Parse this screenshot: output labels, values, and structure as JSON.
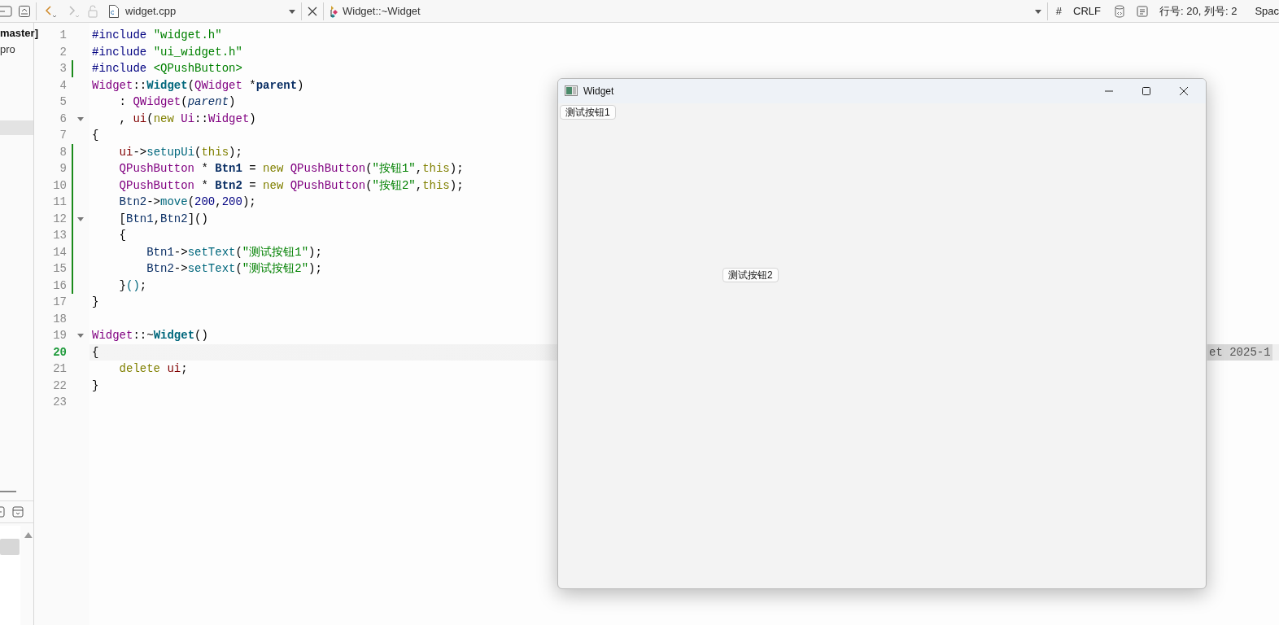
{
  "sidebar": {
    "items": [
      {
        "label": "master]",
        "bold": true
      },
      {
        "label": "pro",
        "bold": false
      }
    ]
  },
  "toolbar": {
    "file_name": "widget.cpp",
    "symbol": "Widget::~Widget",
    "hash": "#",
    "line_ending": "CRLF",
    "position": "行号: 20, 列号: 2",
    "indent": "Spac"
  },
  "editor": {
    "annotation": "et 2025-1",
    "lines": [
      {
        "number": "1",
        "changed": false,
        "foldable": false,
        "current": false,
        "tokens": [
          {
            "kind": "pp",
            "text": "#include "
          },
          {
            "kind": "str",
            "text": "\"widget.h\""
          }
        ]
      },
      {
        "number": "2",
        "changed": false,
        "foldable": false,
        "current": false,
        "tokens": [
          {
            "kind": "pp",
            "text": "#include "
          },
          {
            "kind": "str",
            "text": "\"ui_widget.h\""
          }
        ]
      },
      {
        "number": "3",
        "changed": true,
        "foldable": false,
        "current": false,
        "tokens": [
          {
            "kind": "pp",
            "text": "#include "
          },
          {
            "kind": "str",
            "text": "<QPushButton>"
          }
        ]
      },
      {
        "number": "4",
        "changed": false,
        "foldable": false,
        "current": false,
        "tokens": [
          {
            "kind": "type",
            "text": "Widget"
          },
          {
            "kind": "plain",
            "text": "::"
          },
          {
            "kind": "decl",
            "text": "Widget"
          },
          {
            "kind": "plain",
            "text": "("
          },
          {
            "kind": "type",
            "text": "QWidget"
          },
          {
            "kind": "plain",
            "text": " *"
          },
          {
            "kind": "param",
            "text": "parent"
          },
          {
            "kind": "plain",
            "text": ")"
          }
        ]
      },
      {
        "number": "5",
        "changed": false,
        "foldable": false,
        "current": false,
        "tokens": [
          {
            "kind": "plain",
            "text": "    : "
          },
          {
            "kind": "type",
            "text": "QWidget"
          },
          {
            "kind": "plain",
            "text": "("
          },
          {
            "kind": "italic",
            "text": "parent"
          },
          {
            "kind": "plain",
            "text": ")"
          }
        ]
      },
      {
        "number": "6",
        "changed": false,
        "foldable": true,
        "current": false,
        "tokens": [
          {
            "kind": "plain",
            "text": "    , "
          },
          {
            "kind": "field",
            "text": "ui"
          },
          {
            "kind": "plain",
            "text": "("
          },
          {
            "kind": "kw",
            "text": "new"
          },
          {
            "kind": "type",
            "text": " Ui"
          },
          {
            "kind": "plain",
            "text": "::"
          },
          {
            "kind": "type",
            "text": "Widget"
          },
          {
            "kind": "plain",
            "text": ")"
          }
        ]
      },
      {
        "number": "7",
        "changed": false,
        "foldable": false,
        "current": false,
        "tokens": [
          {
            "kind": "plain",
            "text": "{"
          }
        ]
      },
      {
        "number": "8",
        "changed": true,
        "foldable": false,
        "current": false,
        "tokens": [
          {
            "kind": "field",
            "text": "    ui"
          },
          {
            "kind": "plain",
            "text": "->"
          },
          {
            "kind": "fn",
            "text": "setupUi"
          },
          {
            "kind": "plain",
            "text": "("
          },
          {
            "kind": "kw",
            "text": "this"
          },
          {
            "kind": "plain",
            "text": ");"
          }
        ]
      },
      {
        "number": "9",
        "changed": true,
        "foldable": false,
        "current": false,
        "tokens": [
          {
            "kind": "type",
            "text": "    QPushButton"
          },
          {
            "kind": "plain",
            "text": " * "
          },
          {
            "kind": "localdecl",
            "text": "Btn1"
          },
          {
            "kind": "plain",
            "text": " = "
          },
          {
            "kind": "kw",
            "text": "new"
          },
          {
            "kind": "type",
            "text": " QPushButton"
          },
          {
            "kind": "plain",
            "text": "("
          },
          {
            "kind": "str",
            "text": "\"按钮1\""
          },
          {
            "kind": "plain",
            "text": ","
          },
          {
            "kind": "kw",
            "text": "this"
          },
          {
            "kind": "plain",
            "text": ");"
          }
        ]
      },
      {
        "number": "10",
        "changed": true,
        "foldable": false,
        "current": false,
        "tokens": [
          {
            "kind": "type",
            "text": "    QPushButton"
          },
          {
            "kind": "plain",
            "text": " * "
          },
          {
            "kind": "localdecl",
            "text": "Btn2"
          },
          {
            "kind": "plain",
            "text": " = "
          },
          {
            "kind": "kw",
            "text": "new"
          },
          {
            "kind": "type",
            "text": " QPushButton"
          },
          {
            "kind": "plain",
            "text": "("
          },
          {
            "kind": "str",
            "text": "\"按钮2\""
          },
          {
            "kind": "plain",
            "text": ","
          },
          {
            "kind": "kw",
            "text": "this"
          },
          {
            "kind": "plain",
            "text": ");"
          }
        ]
      },
      {
        "number": "11",
        "changed": true,
        "foldable": false,
        "current": false,
        "tokens": [
          {
            "kind": "local",
            "text": "    Btn2"
          },
          {
            "kind": "plain",
            "text": "->"
          },
          {
            "kind": "fn",
            "text": "move"
          },
          {
            "kind": "plain",
            "text": "("
          },
          {
            "kind": "num",
            "text": "200"
          },
          {
            "kind": "plain",
            "text": ","
          },
          {
            "kind": "num",
            "text": "200"
          },
          {
            "kind": "plain",
            "text": ");"
          }
        ]
      },
      {
        "number": "12",
        "changed": true,
        "foldable": true,
        "current": false,
        "tokens": [
          {
            "kind": "plain",
            "text": "    ["
          },
          {
            "kind": "local",
            "text": "Btn1"
          },
          {
            "kind": "plain",
            "text": ","
          },
          {
            "kind": "local",
            "text": "Btn2"
          },
          {
            "kind": "plain",
            "text": "]()"
          }
        ]
      },
      {
        "number": "13",
        "changed": true,
        "foldable": false,
        "current": false,
        "tokens": [
          {
            "kind": "plain",
            "text": "    {"
          }
        ]
      },
      {
        "number": "14",
        "changed": true,
        "foldable": false,
        "current": false,
        "tokens": [
          {
            "kind": "local",
            "text": "        Btn1"
          },
          {
            "kind": "plain",
            "text": "->"
          },
          {
            "kind": "fn",
            "text": "setText"
          },
          {
            "kind": "plain",
            "text": "("
          },
          {
            "kind": "str",
            "text": "\"测试按钮1\""
          },
          {
            "kind": "plain",
            "text": ");"
          }
        ]
      },
      {
        "number": "15",
        "changed": true,
        "foldable": false,
        "current": false,
        "tokens": [
          {
            "kind": "local",
            "text": "        Btn2"
          },
          {
            "kind": "plain",
            "text": "->"
          },
          {
            "kind": "fn",
            "text": "setText"
          },
          {
            "kind": "plain",
            "text": "("
          },
          {
            "kind": "str",
            "text": "\"测试按钮2\""
          },
          {
            "kind": "plain",
            "text": ");"
          }
        ]
      },
      {
        "number": "16",
        "changed": true,
        "foldable": false,
        "current": false,
        "tokens": [
          {
            "kind": "plain",
            "text": "    }"
          },
          {
            "kind": "fn",
            "text": "()"
          },
          {
            "kind": "plain",
            "text": ";"
          }
        ]
      },
      {
        "number": "17",
        "changed": false,
        "foldable": false,
        "current": false,
        "tokens": [
          {
            "kind": "plain",
            "text": "}"
          }
        ]
      },
      {
        "number": "18",
        "changed": false,
        "foldable": false,
        "current": false
      },
      {
        "number": "19",
        "changed": false,
        "foldable": true,
        "current": false,
        "tokens": [
          {
            "kind": "type",
            "text": "Widget"
          },
          {
            "kind": "plain",
            "text": "::~"
          },
          {
            "kind": "decl",
            "text": "Widget"
          },
          {
            "kind": "plain",
            "text": "()"
          }
        ]
      },
      {
        "number": "20",
        "changed": false,
        "foldable": false,
        "current": true,
        "tokens": [
          {
            "kind": "plain",
            "text": "{"
          }
        ]
      },
      {
        "number": "21",
        "changed": false,
        "foldable": false,
        "current": false,
        "tokens": [
          {
            "kind": "kw",
            "text": "    delete"
          },
          {
            "kind": "field",
            "text": " ui"
          },
          {
            "kind": "plain",
            "text": ";"
          }
        ]
      },
      {
        "number": "22",
        "changed": false,
        "foldable": false,
        "current": false,
        "tokens": [
          {
            "kind": "plain",
            "text": "}"
          }
        ]
      },
      {
        "number": "23",
        "changed": false,
        "foldable": false,
        "current": false
      }
    ]
  },
  "widget_window": {
    "title": "Widget",
    "buttons": [
      {
        "label": "测试按钮1"
      },
      {
        "label": "测试按钮2"
      }
    ]
  }
}
